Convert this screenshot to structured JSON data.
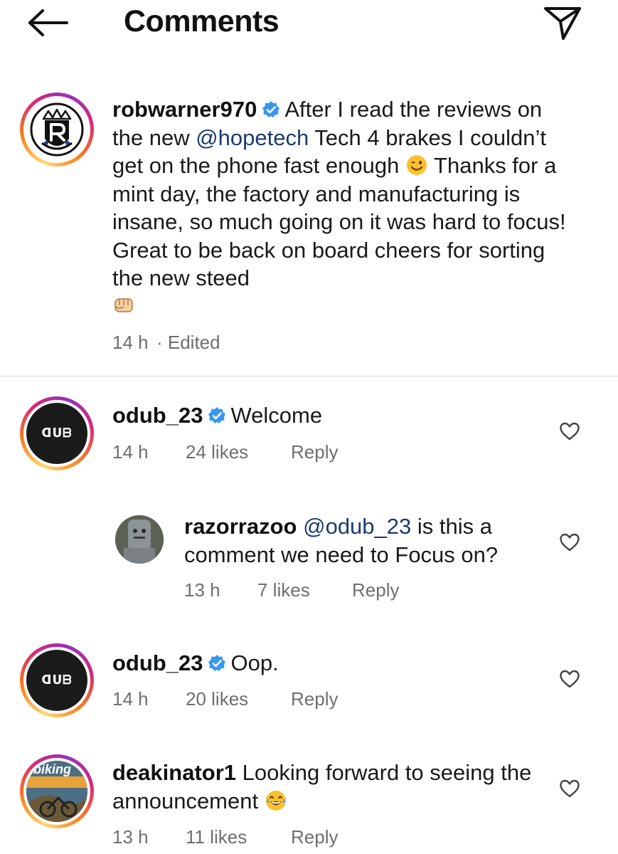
{
  "header": {
    "title": "Comments"
  },
  "caption": {
    "username": "robwarner970",
    "text_before_mention": "After I read the reviews on the new ",
    "mention": "@hopetech",
    "text_after_mention": " Tech 4 brakes I couldn’t get on the phone fast enough ",
    "text_line_2": "Thanks for a mint day, the factory and manufacturing is insane, so much going on it was hard to focus! Great to be back on board cheers for sorting the new steed",
    "time": "14 h",
    "edited": "· Edited"
  },
  "comments": [
    {
      "username": "odub_23",
      "text": "Welcome",
      "time": "14 h",
      "likes": "24 likes",
      "reply": "Reply",
      "avatar_text": "ᗡᑌᗷ"
    },
    {
      "username": "razorrazoo",
      "mention": "@odub_23",
      "text": " is this a comment we need to Focus on?",
      "time": "13 h",
      "likes": "7 likes",
      "reply": "Reply"
    },
    {
      "username": "odub_23",
      "text": "Oop.",
      "time": "14 h",
      "likes": "20 likes",
      "reply": "Reply",
      "avatar_text": "ᗡᑌᗷ"
    },
    {
      "username": "deakinator1",
      "text": " Looking forward to seeing the announcement ",
      "time": "13 h",
      "likes": "11 likes",
      "reply": "Reply",
      "avatar_text": "biking"
    }
  ],
  "colors": {
    "verified": "#3897f0",
    "mention": "#1c3b6e",
    "meta": "#6e6e6e"
  },
  "icons": {
    "back": "arrow-left-icon",
    "send": "paper-plane-icon",
    "like": "heart-outline-icon",
    "verified": "verified-badge-icon"
  }
}
